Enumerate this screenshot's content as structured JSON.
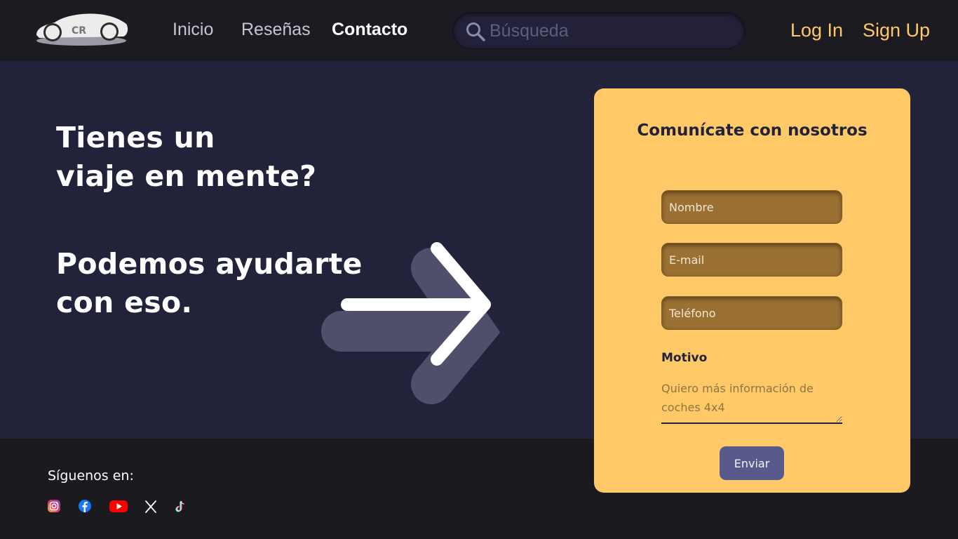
{
  "header": {
    "logo_text": "CR",
    "nav": [
      {
        "label": "Inicio"
      },
      {
        "label": "Reseñas"
      },
      {
        "label": "Contacto",
        "active": true
      }
    ],
    "search": {
      "placeholder": "Búsqueda",
      "icon": "search-icon"
    },
    "auth": {
      "login": "Log In",
      "signup": "Sign Up"
    }
  },
  "hero": {
    "line1": "Tienes un",
    "line2": "viaje en mente?",
    "line3": "Podemos ayudarte",
    "line4": "con eso.",
    "icon": "arrow-right-icon"
  },
  "form": {
    "title": "Comunícate con nosotros",
    "name_placeholder": "Nombre",
    "email_placeholder": "E-mail",
    "phone_placeholder": "Teléfono",
    "motivo_label": "Motivo",
    "motivo_placeholder": "Quiero más información de coches 4x4",
    "submit_label": "Enviar"
  },
  "footer": {
    "follow_label": "Síguenos en:",
    "social": [
      "instagram-icon",
      "facebook-icon",
      "youtube-icon",
      "x-icon",
      "tiktok-icon"
    ]
  },
  "colors": {
    "header_bg": "#1c1b21",
    "hero_bg": "#22223b",
    "accent": "#ffc967",
    "field_bg": "#9a7033",
    "button_bg": "#585a8c"
  }
}
